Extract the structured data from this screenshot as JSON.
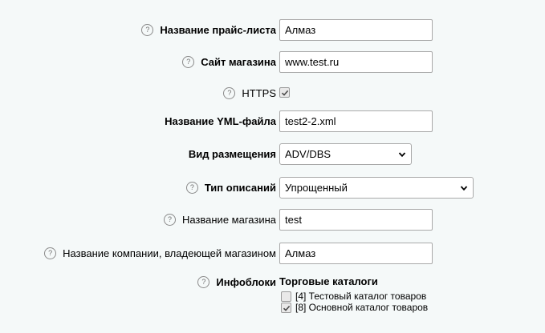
{
  "form": {
    "price_list_name": {
      "label": "Название прайс-листа",
      "value": "Алмаз"
    },
    "shop_site": {
      "label": "Сайт магазина",
      "value": "www.test.ru"
    },
    "https": {
      "label": "HTTPS",
      "checked": true
    },
    "yml_file_name": {
      "label": "Название YML-файла",
      "value": "test2-2.xml"
    },
    "placement_type": {
      "label": "Вид размещения",
      "value": "ADV/DBS"
    },
    "description_type": {
      "label": "Тип описаний",
      "value": "Упрощенный"
    },
    "shop_name": {
      "label": "Название магазина",
      "value": "test"
    },
    "company_name": {
      "label": "Название компании, владеющей магазином",
      "value": "Алмаз"
    },
    "infoblocks": {
      "label": "Инфоблоки",
      "group_title": "Торговые каталоги",
      "items": [
        {
          "label": "[4] Тестовый каталог товаров",
          "checked": false
        },
        {
          "label": "[8] Основной каталог товаров",
          "checked": true
        }
      ]
    },
    "help_symbol": "?"
  }
}
